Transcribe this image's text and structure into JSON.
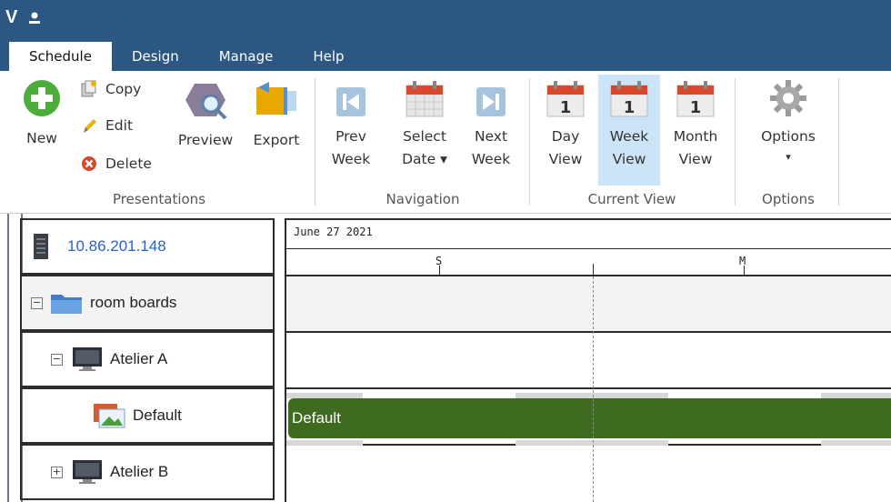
{
  "app": {
    "logo_letter": "V"
  },
  "tabs": [
    {
      "label": "Schedule"
    },
    {
      "label": "Design"
    },
    {
      "label": "Manage"
    },
    {
      "label": "Help"
    }
  ],
  "ribbon": {
    "new_label": "New",
    "copy_label": "Copy",
    "edit_label": "Edit",
    "delete_label": "Delete",
    "preview_label": "Preview",
    "export_label": "Export",
    "group_presentations": "Presentations",
    "prev_week_1": "Prev",
    "prev_week_2": "Week",
    "select_date_1": "Select",
    "select_date_2": "Date ▾",
    "next_week_1": "Next",
    "next_week_2": "Week",
    "group_navigation": "Navigation",
    "day_view_1": "Day",
    "day_view_2": "View",
    "week_view_1": "Week",
    "week_view_2": "View",
    "month_view_1": "Month",
    "month_view_2": "View",
    "group_current_view": "Current View",
    "options_label": "Options",
    "options_arrow": "▾",
    "group_options": "Options",
    "calendar_day_number": "1"
  },
  "tree": {
    "server": "10.86.201.148",
    "folder": "room boards",
    "device_a": "Atelier A",
    "presentation": "Default",
    "device_b": "Atelier B",
    "collapse_symbol": "−",
    "expand_symbol": "+"
  },
  "timeline": {
    "date": "June 27 2021",
    "days": [
      "S",
      "M"
    ],
    "bar_label": "Default"
  },
  "colors": {
    "titlebar": "#2b5782",
    "bar": "#3f6b21",
    "server_text": "#2a62c4",
    "active_view": "#cce4f7"
  }
}
